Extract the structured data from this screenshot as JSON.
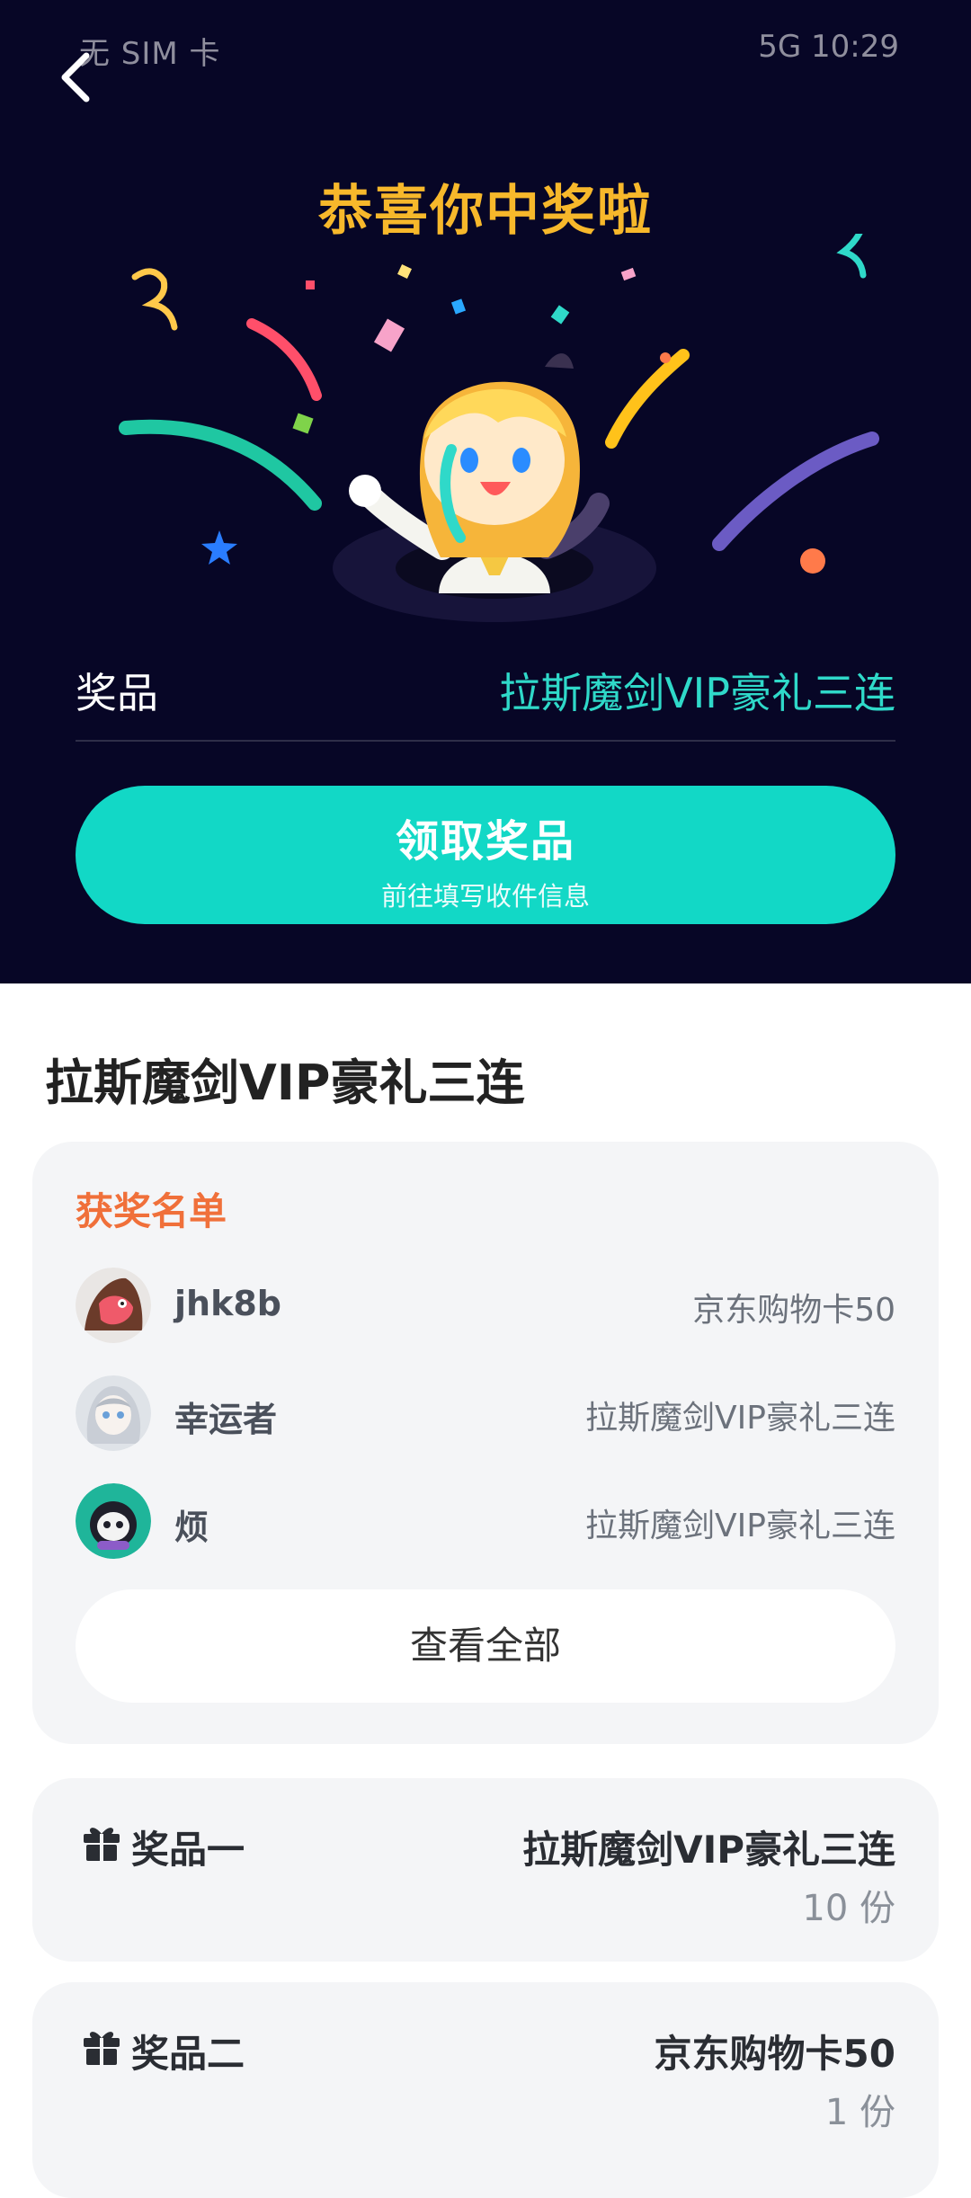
{
  "status_bar": {
    "left_text": "无 SIM 卡",
    "right_text": "5G  10:29"
  },
  "hero": {
    "title": "恭喜你中奖啦",
    "prize_label": "奖品",
    "prize_value": "拉斯魔剑VIP豪礼三连",
    "claim_button_label": "领取奖品",
    "claim_button_sublabel": "前往填写收件信息"
  },
  "main": {
    "title": "拉斯魔剑VIP豪礼三连",
    "winners": {
      "heading": "获奖名单",
      "items": [
        {
          "name": "jhk8b",
          "prize": "京东购物卡50"
        },
        {
          "name": "幸运者",
          "prize": "拉斯魔剑VIP豪礼三连"
        },
        {
          "name": "烦",
          "prize": "拉斯魔剑VIP豪礼三连"
        }
      ],
      "view_all_label": "查看全部"
    },
    "prizes": [
      {
        "tier": "奖品一",
        "name": "拉斯魔剑VIP豪礼三连",
        "quantity": "10 份"
      },
      {
        "tier": "奖品二",
        "name": "京东购物卡50",
        "quantity": "1 份"
      }
    ]
  },
  "colors": {
    "hero_bg": "#070626",
    "title_gold": "#f7b82b",
    "accent_teal": "#12d8c6",
    "winners_heading": "#f0703a"
  }
}
